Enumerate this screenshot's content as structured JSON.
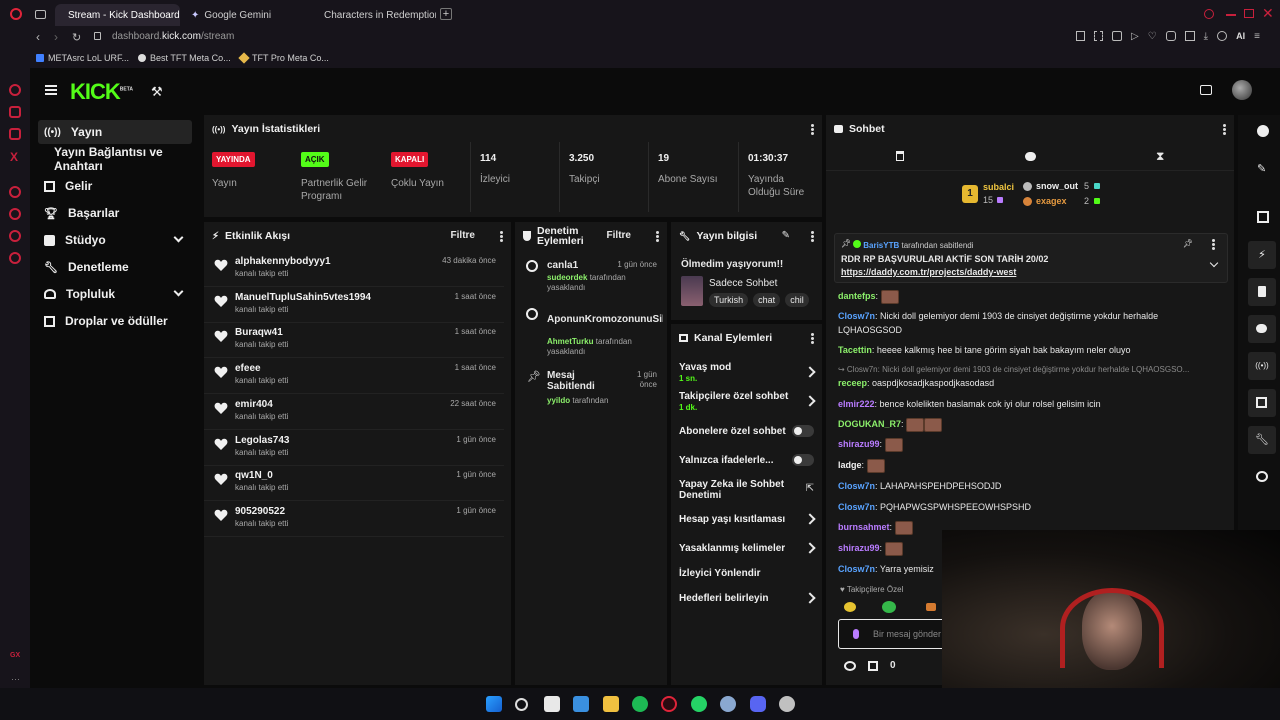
{
  "browser": {
    "tabs": [
      {
        "label": "Stream - Kick Dashboard",
        "active": true
      },
      {
        "label": "Google Gemini",
        "active": false
      },
      {
        "label": "Characters in Redemption",
        "active": false
      }
    ],
    "url": {
      "prefix": "dashboard.",
      "domain": "kick.com",
      "path": "/stream"
    },
    "ai_label": "AI",
    "bookmarks": [
      "METAsrc LoL URF...",
      "Best TFT Meta Co...",
      "TFT Pro Meta Co..."
    ],
    "side_label": "GX"
  },
  "kick": {
    "logo": "KICK",
    "logo_sup": "BETA"
  },
  "nav": {
    "items": [
      {
        "label": "Yayın"
      },
      {
        "label": "Yayın Bağlantısı ve Anahtarı"
      },
      {
        "label": "Gelir"
      },
      {
        "label": "Başarılar"
      },
      {
        "label": "Stüdyo"
      },
      {
        "label": "Denetleme"
      },
      {
        "label": "Topluluk"
      },
      {
        "label": "Droplar ve ödüller"
      }
    ]
  },
  "stats": {
    "title": "Yayın İstatistikleri",
    "items": [
      {
        "badge": "YAYINDA",
        "label": "Yayın",
        "color": "#e2162f"
      },
      {
        "badge": "AÇIK",
        "label": "Partnerlik Gelir Programı",
        "color": "#53fc18"
      },
      {
        "badge": "KAPALI",
        "label": "Çoklu Yayın",
        "color": "#e2162f"
      },
      {
        "value": "114",
        "label": "İzleyici"
      },
      {
        "value": "3.250",
        "label": "Takipçi"
      },
      {
        "value": "19",
        "label": "Abone Sayısı"
      },
      {
        "value": "01:30:37",
        "label": "Yayında Olduğu Süre"
      }
    ]
  },
  "activity": {
    "title": "Etkinlik Akışı",
    "filter": "Filtre",
    "items": [
      {
        "name": "alphakennybodyyy1",
        "sub": "kanalı takip etti",
        "time": "43 dakika önce"
      },
      {
        "name": "ManuelTupluSahin5vtes1994",
        "sub": "kanalı takip etti",
        "time": "1 saat önce"
      },
      {
        "name": "Buraqw41",
        "sub": "kanalı takip etti",
        "time": "1 saat önce"
      },
      {
        "name": "efeee",
        "sub": "kanalı takip etti",
        "time": "1 saat önce"
      },
      {
        "name": "emir404",
        "sub": "kanalı takip etti",
        "time": "22 saat önce"
      },
      {
        "name": "Legolas743",
        "sub": "kanalı takip etti",
        "time": "1 gün önce"
      },
      {
        "name": "qw1N_0",
        "sub": "kanalı takip etti",
        "time": "1 gün önce"
      },
      {
        "name": "905290522",
        "sub": "kanalı takip etti",
        "time": "1 gün önce"
      }
    ]
  },
  "moderation": {
    "title": "Denetim Eylemleri",
    "filter": "Filtre",
    "items": [
      {
        "name": "canla1",
        "time": "1 gün önce",
        "by": "sudeordek",
        "by_suffix": "tarafından",
        "action": "yasaklandı"
      },
      {
        "name": "AponunKromozonunuSik",
        "time": "",
        "by": "AhmetTurku",
        "by_suffix": "tarafından",
        "action": "yasaklandı"
      },
      {
        "name": "Mesaj Sabitlendi",
        "time": "1 gün önce",
        "by": "yyildo",
        "by_suffix": "tarafından",
        "action": ""
      }
    ]
  },
  "stream_info": {
    "title": "Yayın bilgisi",
    "stream_title": "Ölmedim yaşıyorum!!",
    "category": "Sadece Sohbet",
    "tags": [
      "Turkish",
      "chat",
      "chil"
    ]
  },
  "channel_actions": {
    "title": "Kanal Eylemleri",
    "items": [
      {
        "label": "Yavaş mod",
        "sub": "1 sn.",
        "type": "chevron"
      },
      {
        "label": "Takipçilere özel sohbet",
        "sub": "1 dk.",
        "type": "chevron"
      },
      {
        "label": "Abonelere özel sohbet",
        "sub": "",
        "type": "toggle"
      },
      {
        "label": "Yalnızca ifadelerle...",
        "sub": "",
        "type": "toggle"
      },
      {
        "label": "Yapay Zeka ile Sohbet Denetimi",
        "sub": "",
        "type": "external"
      },
      {
        "label": "Hesap yaşı kısıtlaması",
        "sub": "",
        "type": "chevron"
      },
      {
        "label": "Yasaklanmış kelimeler",
        "sub": "",
        "type": "chevron"
      },
      {
        "label": "İzleyici Yönlendir",
        "sub": "",
        "type": "none"
      },
      {
        "label": "Hedefleri belirleyin",
        "sub": "",
        "type": "chevron"
      }
    ]
  },
  "chat": {
    "title": "Sohbet",
    "leaderboard": [
      {
        "name": "subalci",
        "count": "15",
        "rank": "1"
      },
      {
        "name": "snow_out",
        "count": "5"
      },
      {
        "name": "exagex",
        "count": "2"
      }
    ],
    "pinned": {
      "user": "BarisYTB",
      "suffix": "tarafından sabitlendi",
      "text": "RDR RP BAŞVURULARI AKTİF SON TARİH 20/02",
      "link": "https://daddy.com.tr/projects/daddy-west"
    },
    "messages": [
      {
        "user": "dantefps",
        "text": "",
        "color": "u-green",
        "emotes": 1
      },
      {
        "user": "Closw7n",
        "text": "Nicki doll gelemiyor demi 1903 de cinsiyet değiştirme yokdur herhalde",
        "color": "u-blue",
        "emotes": 0
      },
      {
        "user": "",
        "text": "LQHAOSGSOD",
        "color": "u-white",
        "emotes": 0
      },
      {
        "user": "Tacettin",
        "text": "heeee kalkmış hee bi tane görim siyah bak bakayım neler oluyo",
        "color": "u-green",
        "emotes": 0
      },
      {
        "user": "↪ Closw7n",
        "text": "Nicki doll gelemiyor demi 1903 de cinsiyet değiştirme yokdur herhalde LQHAOSGSO...",
        "color": "u-reply",
        "emotes": 0
      },
      {
        "user": "receep",
        "text": "oaspdjkosadjkaspodjkasodasd",
        "color": "u-green",
        "emotes": 0
      },
      {
        "user": "elmir222",
        "text": "bence kolelikten baslamak cok iyi olur rolsel gelisim icin",
        "color": "u-purple",
        "emotes": 0
      },
      {
        "user": "DOGUKAN_R7",
        "text": "",
        "color": "u-green",
        "emotes": 2
      },
      {
        "user": "shirazu99",
        "text": "",
        "color": "u-purple",
        "emotes": 1
      },
      {
        "user": "ladge",
        "text": "",
        "color": "u-white",
        "emotes": 1
      },
      {
        "user": "Closw7n",
        "text": "LAHAPAHSPEHDPEHSODJD",
        "color": "u-blue",
        "emotes": 0
      },
      {
        "user": "Closw7n",
        "text": "PQHAPWGSPWHSPEEOWHSPSHD",
        "color": "u-blue",
        "emotes": 0
      },
      {
        "user": "burnsahmet",
        "text": "",
        "color": "u-purple",
        "emotes": 1
      },
      {
        "user": "shirazu99",
        "text": "",
        "color": "u-purple",
        "emotes": 1
      },
      {
        "user": "Closw7n",
        "text": "Yarra yemisiz",
        "color": "u-blue",
        "emotes": 0
      }
    ],
    "followers_only": "Takipçilere Özel",
    "input_placeholder": "Bir mesaj gönder",
    "points": "0"
  }
}
